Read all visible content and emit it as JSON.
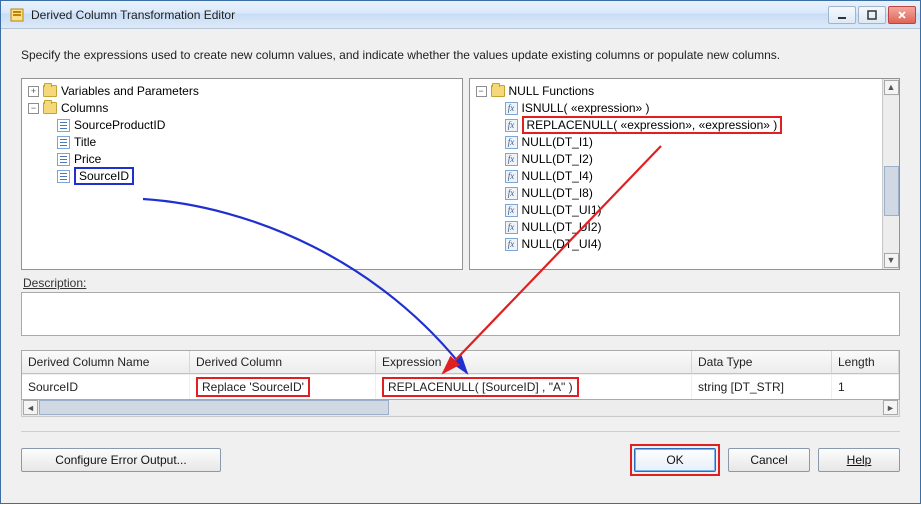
{
  "window": {
    "title": "Derived Column Transformation Editor"
  },
  "instruction": "Specify the expressions used to create new column values, and indicate whether the values update existing columns or populate new columns.",
  "left_tree": {
    "nodes": [
      {
        "expand": "+",
        "icon": "folder",
        "label": "Variables and Parameters",
        "indent": 0
      },
      {
        "expand": "−",
        "icon": "folder",
        "label": "Columns",
        "indent": 0
      },
      {
        "expand": "",
        "icon": "column",
        "label": "SourceProductID",
        "indent": 1
      },
      {
        "expand": "",
        "icon": "column",
        "label": "Title",
        "indent": 1
      },
      {
        "expand": "",
        "icon": "column",
        "label": "Price",
        "indent": 1
      },
      {
        "expand": "",
        "icon": "column",
        "label": "SourceID",
        "indent": 1,
        "highlight": "blue"
      }
    ]
  },
  "right_tree": {
    "nodes": [
      {
        "expand": "−",
        "icon": "folder",
        "label": "NULL Functions",
        "indent": 0
      },
      {
        "expand": "",
        "icon": "fx",
        "label": "ISNULL( «expression» )",
        "indent": 1
      },
      {
        "expand": "",
        "icon": "fx",
        "label": "REPLACENULL( «expression», «expression» )",
        "indent": 1,
        "highlight": "red"
      },
      {
        "expand": "",
        "icon": "fx",
        "label": "NULL(DT_I1)",
        "indent": 1
      },
      {
        "expand": "",
        "icon": "fx",
        "label": "NULL(DT_I2)",
        "indent": 1
      },
      {
        "expand": "",
        "icon": "fx",
        "label": "NULL(DT_I4)",
        "indent": 1
      },
      {
        "expand": "",
        "icon": "fx",
        "label": "NULL(DT_I8)",
        "indent": 1
      },
      {
        "expand": "",
        "icon": "fx",
        "label": "NULL(DT_UI1)",
        "indent": 1
      },
      {
        "expand": "",
        "icon": "fx",
        "label": "NULL(DT_UI2)",
        "indent": 1
      },
      {
        "expand": "",
        "icon": "fx",
        "label": "NULL(DT_UI4)",
        "indent": 1
      }
    ]
  },
  "description": {
    "label": "Description:",
    "value": ""
  },
  "grid": {
    "headers": {
      "a": "Derived Column Name",
      "b": "Derived Column",
      "c": "Expression",
      "d": "Data Type",
      "e": "Length"
    },
    "row": {
      "name": "SourceID",
      "derived": "Replace 'SourceID'",
      "expression": "REPLACENULL( [SourceID] , \"A\" )",
      "datatype": "string [DT_STR]",
      "length": "1"
    }
  },
  "buttons": {
    "configure": "Configure Error Output...",
    "ok": "OK",
    "cancel": "Cancel",
    "help": "Help"
  }
}
